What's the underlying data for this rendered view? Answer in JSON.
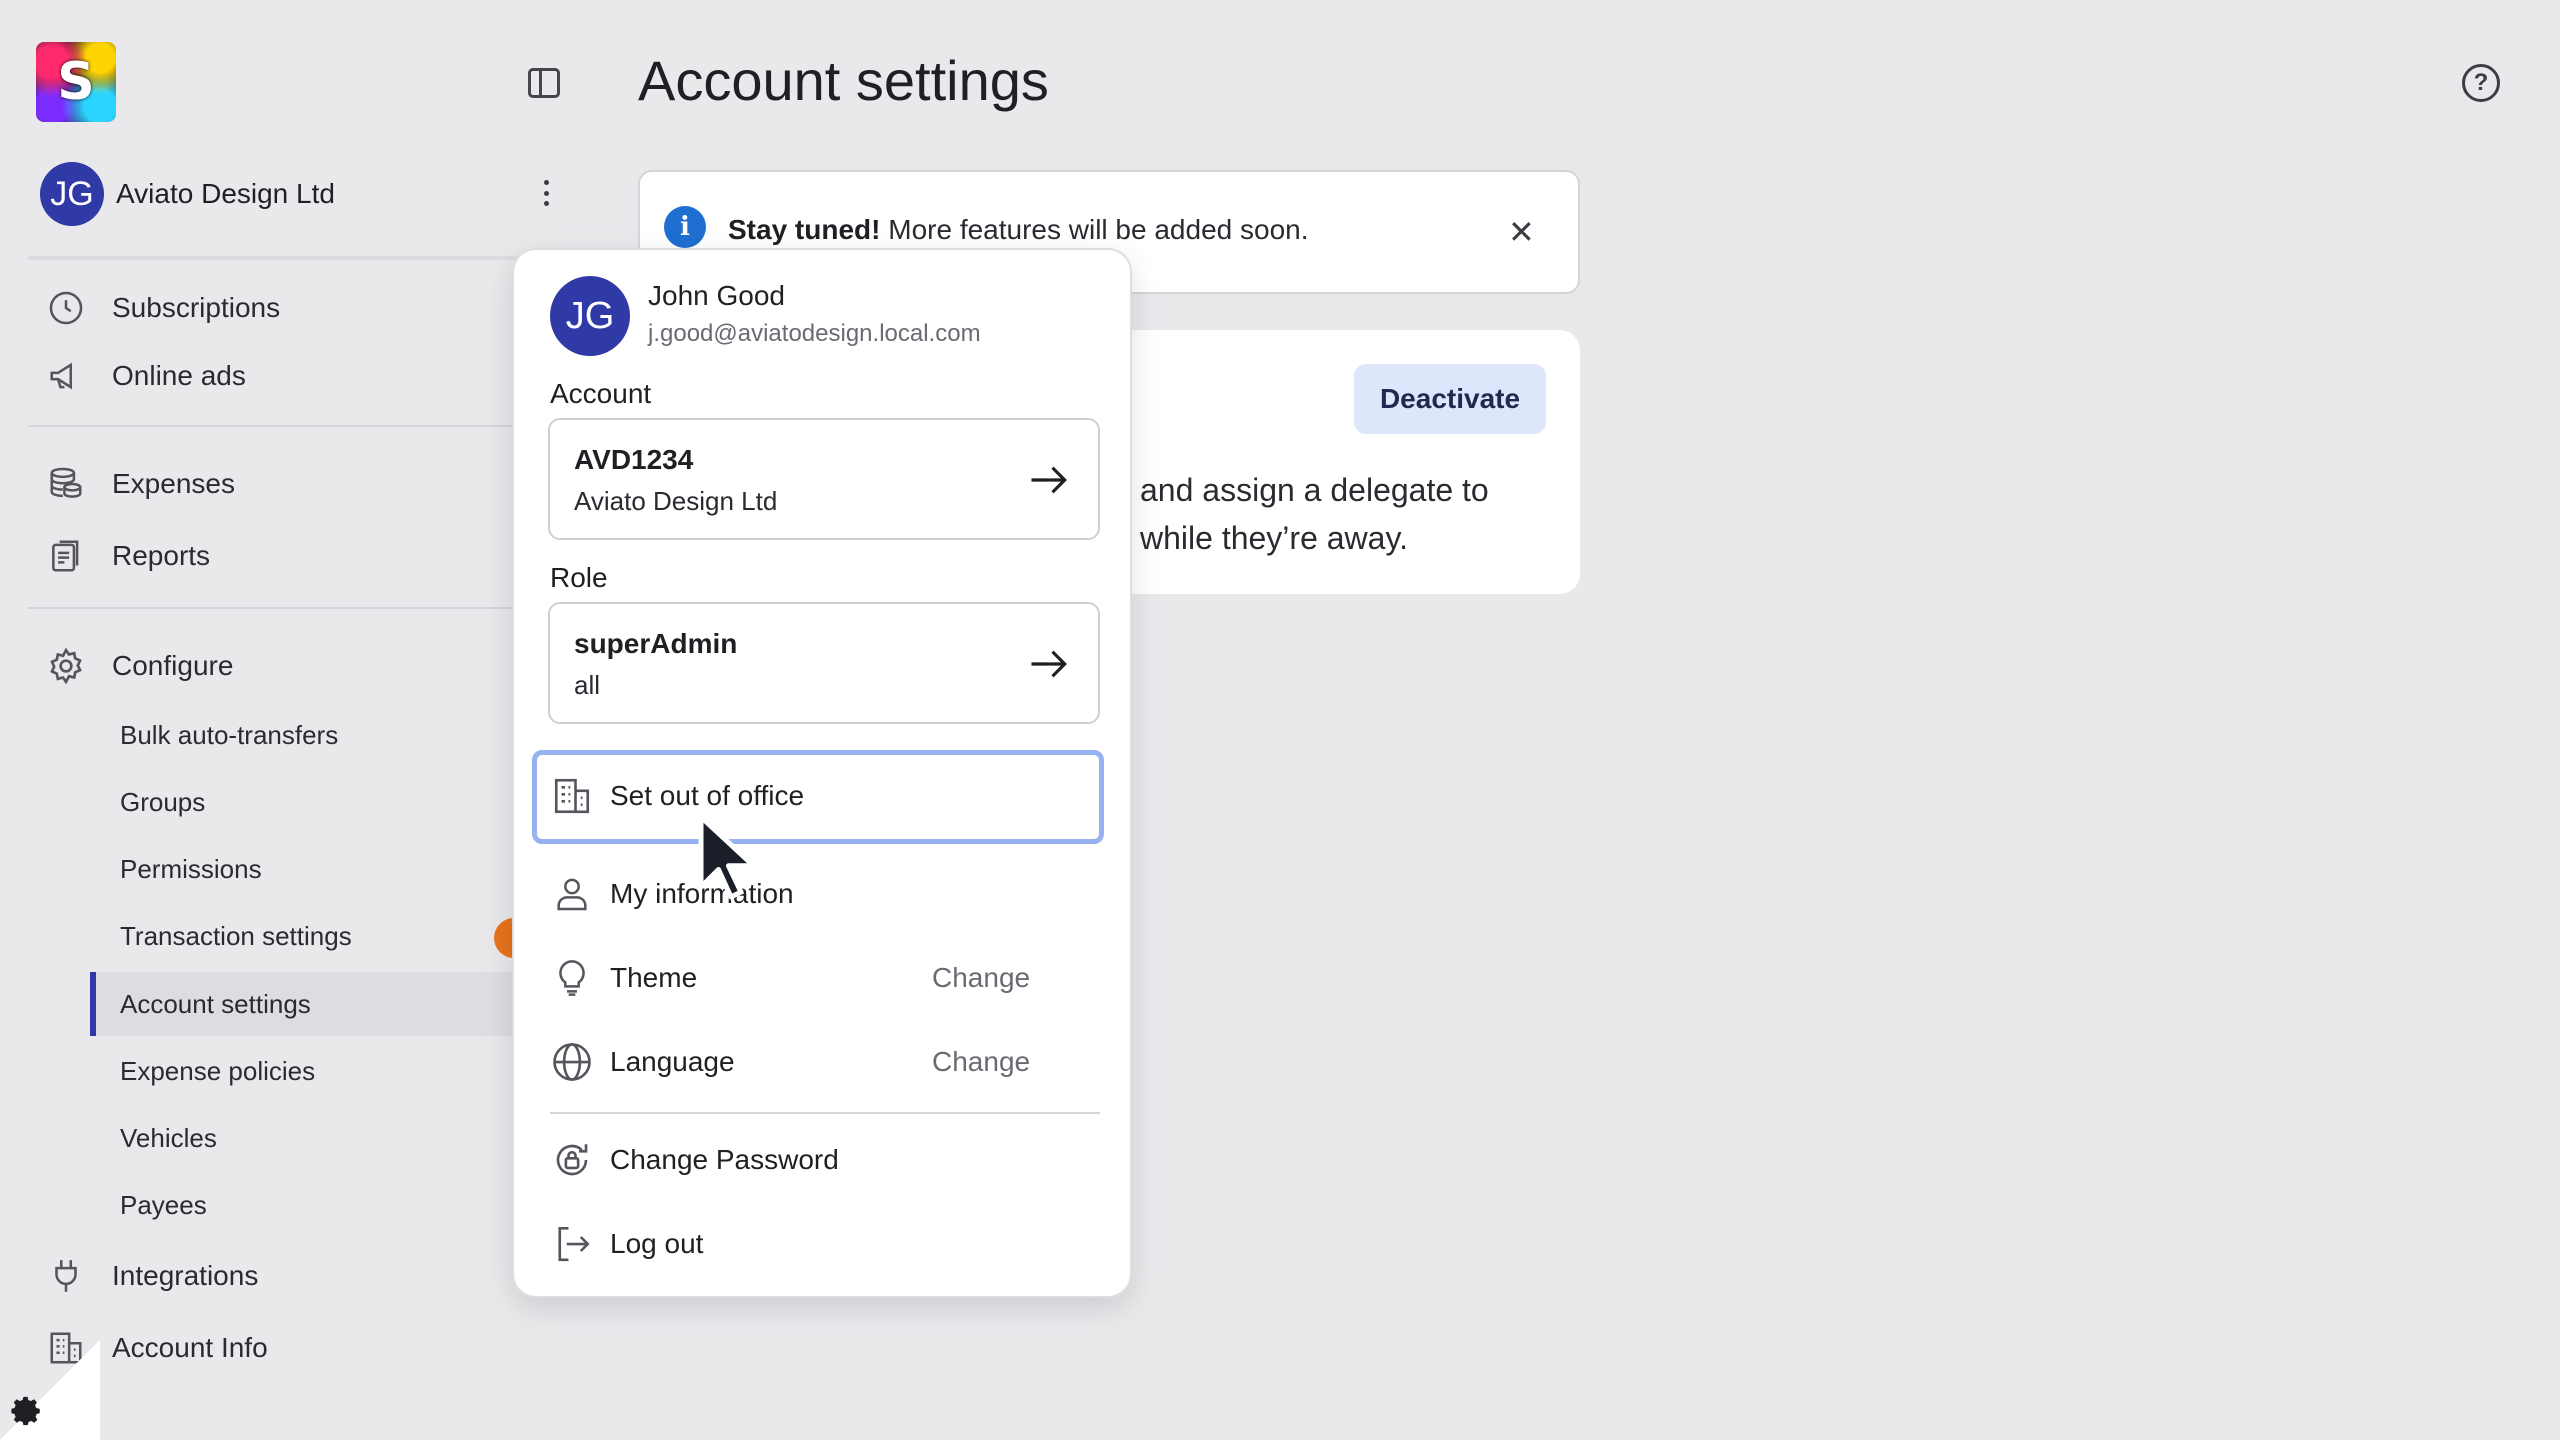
{
  "app": {
    "logo_letter": "S"
  },
  "org": {
    "initials": "JG",
    "name": "Aviato Design Ltd"
  },
  "sidebar": {
    "items": [
      {
        "label": "Subscriptions",
        "icon": "clock-icon"
      },
      {
        "label": "Online ads",
        "icon": "megaphone-icon"
      },
      {
        "label": "Expenses",
        "icon": "coins-icon"
      },
      {
        "label": "Reports",
        "icon": "report-icon"
      },
      {
        "label": "Configure",
        "icon": "gear-icon"
      },
      {
        "label": "Integrations",
        "icon": "plug-icon"
      },
      {
        "label": "Account Info",
        "icon": "building-icon"
      }
    ],
    "configure_items": [
      "Bulk auto-transfers",
      "Groups",
      "Permissions",
      "Transaction settings",
      "Account settings",
      "Expense policies",
      "Vehicles",
      "Payees"
    ],
    "active_item": "Account settings"
  },
  "page": {
    "title": "Account settings",
    "banner": {
      "bold": "Stay tuned!",
      "text": " More features will be added soon."
    },
    "card": {
      "button": "Deactivate",
      "line1": "and assign a delegate to",
      "line2": "while they’re away."
    }
  },
  "menu": {
    "user": {
      "initials": "JG",
      "name": "John Good",
      "email": "j.good@aviatodesign.local.com"
    },
    "account_label": "Account",
    "account": {
      "code": "AVD1234",
      "name": "Aviato Design Ltd"
    },
    "role_label": "Role",
    "role": {
      "name": "superAdmin",
      "scope": "all"
    },
    "items": [
      {
        "label": "Set out of office",
        "icon": "building-icon"
      },
      {
        "label": "My information",
        "icon": "person-icon"
      },
      {
        "label": "Theme",
        "icon": "lightbulb-icon",
        "action": "Change"
      },
      {
        "label": "Language",
        "icon": "globe-icon",
        "action": "Change"
      },
      {
        "label": "Change Password",
        "icon": "lock-refresh-icon"
      },
      {
        "label": "Log out",
        "icon": "logout-icon"
      }
    ]
  },
  "colors": {
    "accent": "#3238a6",
    "avatar": "#2f3aa6",
    "focus_ring": "#96b2f0",
    "info": "#1f6fd1",
    "badge": "#e8731d"
  }
}
